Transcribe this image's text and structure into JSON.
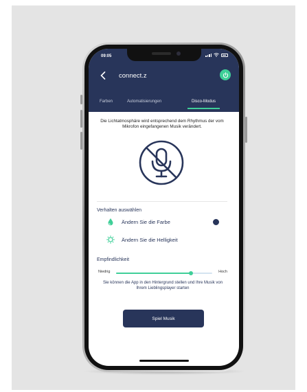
{
  "status": {
    "time": "09:05"
  },
  "header": {
    "title": "connect.z",
    "accent_color": "#3fcf98",
    "bar_color": "#28355a",
    "back_icon": "chevron-left-icon",
    "power_icon": "power-icon"
  },
  "tabs": [
    {
      "label": "Farben",
      "active": false
    },
    {
      "label": "Automatisierungen",
      "active": false
    },
    {
      "label": "Disco-Modus",
      "active": true
    }
  ],
  "main": {
    "description": "Die Lichtatmosphäre wird entsprechend dem Rhythmus der vom Mikrofon eingefangenen Musik verändert.",
    "mic_icon": "microphone-off-icon"
  },
  "behavior": {
    "title": "Verhalten auswählen",
    "options": [
      {
        "label": "Ändern Sie die Farbe",
        "icon": "color-drop-icon",
        "selected": true
      },
      {
        "label": "Ändern Sie die Helligkeit",
        "icon": "brightness-icon",
        "selected": false
      }
    ]
  },
  "sensitivity": {
    "title": "Empfindlichkeit",
    "low_label": "Niedrig",
    "high_label": "Hoch",
    "value_percent": 78
  },
  "info": "Sie können die App in den Hintergrund stellen und Ihre Musik von Ihrem Lieblingsplayer starten",
  "play_button": "Spiel Musik"
}
